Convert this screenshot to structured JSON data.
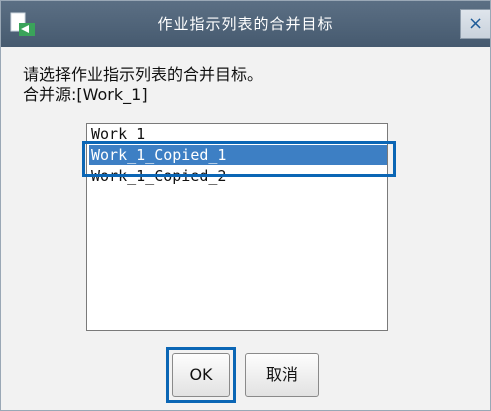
{
  "window": {
    "title": "作业指示列表的合并目标",
    "close_label": "×"
  },
  "prompt": {
    "line1": "请选择作业指示列表的合并目标。",
    "line2": "合并源:[Work_1]"
  },
  "list": {
    "items": [
      "Work_1",
      "Work_1_Copied_1",
      "Work_1_Copied_2"
    ],
    "selected": "Work_1_Copied_1"
  },
  "buttons": {
    "ok_label": "OK",
    "cancel_label": "取消"
  },
  "colors": {
    "titlebar": "#4f6378",
    "selection": "#3d7fc4",
    "callout": "#0b66b5"
  },
  "icons": {
    "app": "transfer-icon",
    "close": "close-icon"
  }
}
